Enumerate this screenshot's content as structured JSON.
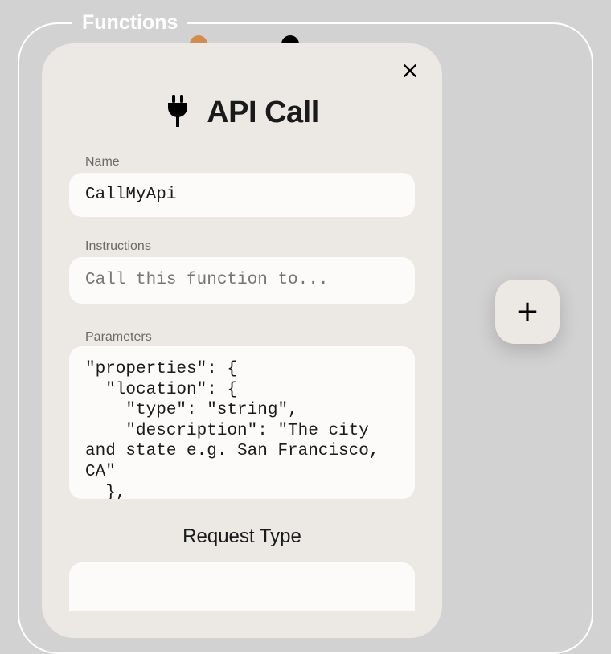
{
  "frame": {
    "label": "Functions"
  },
  "dots": {
    "orange_color": "#d08d4e",
    "black_color": "#000000"
  },
  "modal": {
    "title": "API Call",
    "fields": {
      "name": {
        "label": "Name",
        "value": "CallMyApi"
      },
      "instructions": {
        "label": "Instructions",
        "placeholder": "Call this function to..."
      },
      "parameters": {
        "label": "Parameters",
        "value": "\"properties\": {\n  \"location\": {\n    \"type\": \"string\",\n    \"description\": \"The city and state e.g. San Francisco, CA\"\n  },\n  \"unit\": {\n    \"type\": \"string\""
      }
    },
    "request_type_title": "Request Type"
  },
  "add_button": {
    "label": "+"
  }
}
